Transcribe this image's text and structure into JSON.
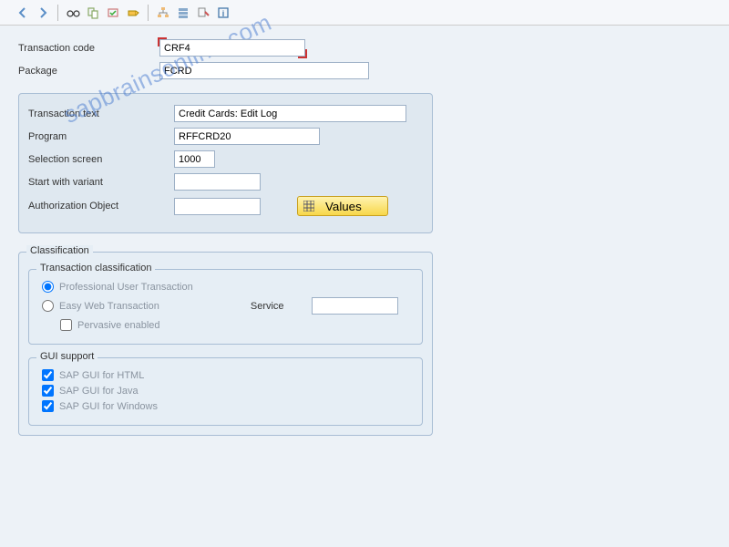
{
  "toolbar": {
    "icons": [
      "back",
      "forward",
      "glasses",
      "copy",
      "activate",
      "transport",
      "hierarchy",
      "stack",
      "test",
      "info"
    ]
  },
  "header": {
    "tcode_label": "Transaction code",
    "tcode_value": "CRF4",
    "package_label": "Package",
    "package_value": "FCRD"
  },
  "details": {
    "tx_text_label": "Transaction text",
    "tx_text_value": "Credit Cards: Edit Log",
    "program_label": "Program",
    "program_value": "RFFCRD20",
    "selscreen_label": "Selection screen",
    "selscreen_value": "1000",
    "variant_label": "Start with variant",
    "variant_value": "",
    "authobj_label": "Authorization Object",
    "authobj_value": "",
    "values_btn": "Values"
  },
  "classification": {
    "outer_title": "Classification",
    "tc_title": "Transaction classification",
    "radio_professional": "Professional User Transaction",
    "radio_easyweb": "Easy Web Transaction",
    "service_label": "Service",
    "service_value": "",
    "pervasive": "Pervasive enabled",
    "gui_title": "GUI support",
    "gui_html": "SAP GUI for HTML",
    "gui_java": "SAP GUI for Java",
    "gui_win": "SAP GUI for Windows"
  },
  "watermark": "sapbrainsonline.com"
}
